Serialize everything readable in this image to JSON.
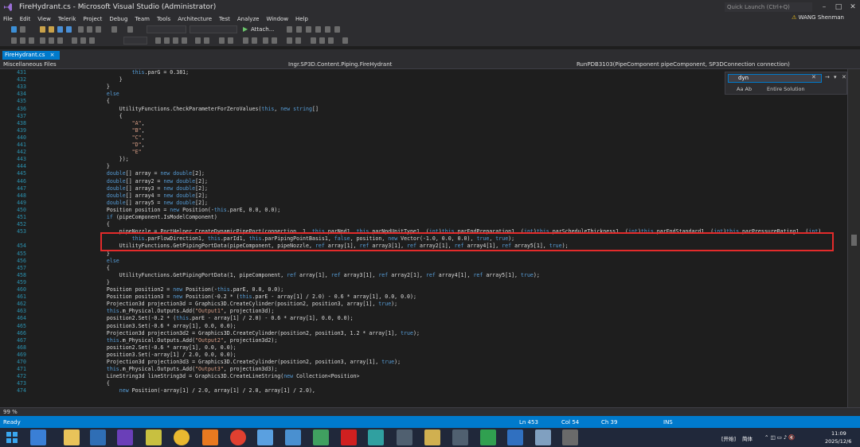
{
  "window": {
    "title": "FireHydrant.cs - Microsoft Visual Studio (Administrator)",
    "quick_launch": "Quick Launch (Ctrl+Q)",
    "user": "WANG Shenman"
  },
  "menu": [
    "File",
    "Edit",
    "View",
    "Telerik",
    "Project",
    "Debug",
    "Team",
    "Tools",
    "Architecture",
    "Test",
    "Analyze",
    "Window",
    "Help"
  ],
  "toolbar": {
    "attach_label": "Attach..."
  },
  "tab": {
    "label": "FireHydrant.cs",
    "close": "×"
  },
  "nav": {
    "project": "Miscellaneous Files",
    "class": "Ingr.SP3D.Content.Piping.FireHydrant",
    "member": "RunPDB3103(PipeComponent pipeComponent, SP3DConnection connection)"
  },
  "find": {
    "value": "dyn",
    "scope": "Entire Solution",
    "options": "Aa  Ab"
  },
  "code": [
    {
      "n": "431",
      "t": "            this.parG = 0.381;"
    },
    {
      "n": "432",
      "t": "        }"
    },
    {
      "n": "433",
      "t": "    }"
    },
    {
      "n": "434",
      "t": "    else"
    },
    {
      "n": "435",
      "t": "    {"
    },
    {
      "n": "436",
      "t": "        UtilityFunctions.CheckParameterForZeroValues(this, new string[]"
    },
    {
      "n": "437",
      "t": "        {"
    },
    {
      "n": "438",
      "t": "            \"A\","
    },
    {
      "n": "439",
      "t": "            \"B\","
    },
    {
      "n": "440",
      "t": "            \"C\","
    },
    {
      "n": "441",
      "t": "            \"D\","
    },
    {
      "n": "442",
      "t": "            \"E\""
    },
    {
      "n": "443",
      "t": "        });"
    },
    {
      "n": "444",
      "t": "    }"
    },
    {
      "n": "445",
      "t": "    double[] array = new double[2];"
    },
    {
      "n": "446",
      "t": "    double[] array2 = new double[2];"
    },
    {
      "n": "447",
      "t": "    double[] array3 = new double[2];"
    },
    {
      "n": "448",
      "t": "    double[] array4 = new double[2];"
    },
    {
      "n": "449",
      "t": "    double[] array5 = new double[2];"
    },
    {
      "n": "450",
      "t": "    Position position = new Position(-this.parE, 0.0, 0.0);"
    },
    {
      "n": "451",
      "t": "    if (pipeComponent.IsModelComponent)"
    },
    {
      "n": "452",
      "t": "    {"
    },
    {
      "n": "453",
      "t": "        pipeNozzle = PortHelper.CreateDynamicPipePort(connection, 1, this.parNpd1, this.parNpdUnitType1, (int)this.parEndPreparation1, (int)this.parScheduleThickness1, (int)this.parEndStandard1, (int)this.parPressureRating1, (int)"
    },
    {
      "n": "",
      "t": "            this.parFlowDirection1, this.parId1, this.parPipingPointBasis1, false, position, new Vector(-1.0, 0.0, 0.0), true, true);"
    },
    {
      "n": "454",
      "t": "        UtilityFunctions.GetPipingPortData(pipeComponent, pipeNozzle, ref array[1], ref array3[1], ref array2[1], ref array4[1], ref array5[1], true);"
    },
    {
      "n": "455",
      "t": "    }"
    },
    {
      "n": "456",
      "t": "    else"
    },
    {
      "n": "457",
      "t": "    {"
    },
    {
      "n": "458",
      "t": "        UtilityFunctions.GetPipingPortData(1, pipeComponent, ref array[1], ref array3[1], ref array2[1], ref array4[1], ref array5[1], true);"
    },
    {
      "n": "459",
      "t": "    }"
    },
    {
      "n": "460",
      "t": "    Position position2 = new Position(-this.parE, 0.0, 0.0);"
    },
    {
      "n": "461",
      "t": "    Position position3 = new Position(-0.2 * (this.parE - array[1] / 2.0) - 0.6 * array[1], 0.0, 0.0);"
    },
    {
      "n": "462",
      "t": "    Projection3d projection3d = Graphics3D.CreateCylinder(position2, position3, array[1], true);"
    },
    {
      "n": "463",
      "t": "    this.m_Physical.Outputs.Add(\"Output1\", projection3d);"
    },
    {
      "n": "464",
      "t": "    position2.Set(-0.2 * (this.parE - array[1] / 2.0) - 0.6 * array[1], 0.0, 0.0);"
    },
    {
      "n": "465",
      "t": "    position3.Set(-0.6 * array[1], 0.0, 0.0);"
    },
    {
      "n": "466",
      "t": "    Projection3d projection3d2 = Graphics3D.CreateCylinder(position2, position3, 1.2 * array[1], true);"
    },
    {
      "n": "467",
      "t": "    this.m_Physical.Outputs.Add(\"Output2\", projection3d2);"
    },
    {
      "n": "468",
      "t": "    position2.Set(-0.6 * array[1], 0.0, 0.0);"
    },
    {
      "n": "469",
      "t": "    position3.Set(-array[1] / 2.0, 0.0, 0.0);"
    },
    {
      "n": "470",
      "t": "    Projection3d projection3d3 = Graphics3D.CreateCylinder(position2, position3, array[1], true);"
    },
    {
      "n": "471",
      "t": "    this.m_Physical.Outputs.Add(\"Output3\", projection3d3);"
    },
    {
      "n": "472",
      "t": "    LineString3d lineString3d = Graphics3D.CreateLineString(new Collection<Position>"
    },
    {
      "n": "473",
      "t": "    {"
    },
    {
      "n": "474",
      "t": "        new Position(-array[1] / 2.0, array[1] / 2.0, array[1] / 2.0),"
    }
  ],
  "zoom": "99 %",
  "status": {
    "ready": "Ready",
    "ln": "Ln 453",
    "col": "Col 54",
    "ch": "Ch 39",
    "ins": "INS"
  },
  "tray": {
    "start_label": "[开始]",
    "lang": "简体",
    "time": "11:09",
    "date": "2025/12/6"
  },
  "colors": {
    "accent": "#007acc",
    "highlight_box": "#e32b2b",
    "keyword": "#569cd6",
    "string": "#d69d85",
    "linenum": "#2b91af"
  }
}
